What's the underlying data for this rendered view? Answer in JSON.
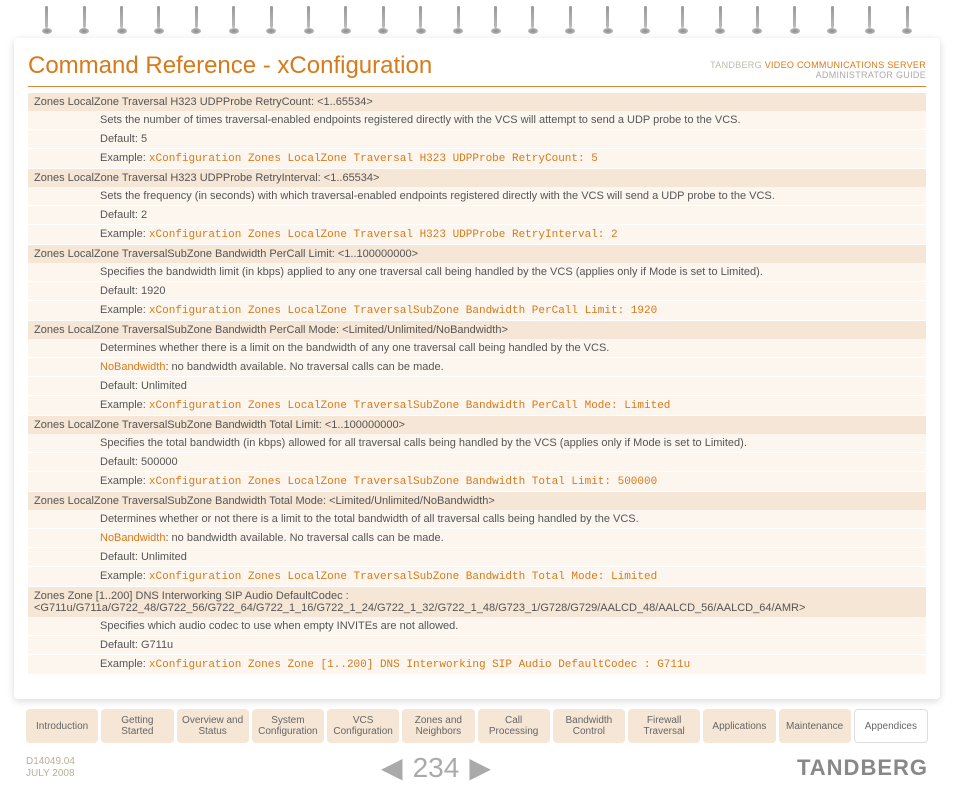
{
  "header": {
    "title": "Command Reference - xConfiguration",
    "brand": "TANDBERG",
    "product": "VIDEO COMMUNICATIONS SERVER",
    "subtitle": "ADMINISTRATOR GUIDE"
  },
  "tabs": [
    "Introduction",
    "Getting Started",
    "Overview and Status",
    "System Configuration",
    "VCS Configuration",
    "Zones and Neighbors",
    "Call Processing",
    "Bandwidth Control",
    "Firewall Traversal",
    "Applications",
    "Maintenance",
    "Appendices"
  ],
  "pager": {
    "page": "234",
    "left": "◀",
    "right": "▶"
  },
  "footer": {
    "docid": "D14049.04",
    "date": "JULY 2008",
    "logo": "TANDBERG"
  },
  "items": [
    {
      "hdr": "Zones LocalZone Traversal H323 UDPProbe RetryCount: <1..65534>",
      "body": [
        "Sets the number of times traversal-enabled endpoints registered directly with the VCS will attempt to send a UDP probe to the VCS.",
        "Default: 5"
      ],
      "example": "xConfiguration Zones LocalZone Traversal H323 UDPProbe RetryCount: 5"
    },
    {
      "hdr": "Zones LocalZone Traversal H323 UDPProbe RetryInterval: <1..65534>",
      "body": [
        "Sets the frequency (in seconds) with which traversal-enabled endpoints registered directly with the VCS will send a UDP probe to the VCS.",
        "Default: 2"
      ],
      "example": "xConfiguration Zones LocalZone Traversal H323 UDPProbe RetryInterval: 2"
    },
    {
      "hdr": "Zones LocalZone TraversalSubZone Bandwidth PerCall Limit: <1..100000000>",
      "body": [
        "Specifies the bandwidth limit (in kbps) applied to any one traversal call being handled by the VCS (applies only if Mode is set to Limited).",
        "Default: 1920"
      ],
      "example": "xConfiguration Zones LocalZone TraversalSubZone Bandwidth PerCall Limit: 1920"
    },
    {
      "hdr": "Zones LocalZone TraversalSubZone Bandwidth PerCall Mode: <Limited/Unlimited/NoBandwidth>",
      "body": [
        "Determines whether there is a limit on the bandwidth of any one traversal call being handled by the VCS."
      ],
      "nobw": {
        "label": "NoBandwidth",
        "text": ": no bandwidth available. No traversal calls can be made."
      },
      "body2": [
        "Default: Unlimited"
      ],
      "example": "xConfiguration Zones LocalZone TraversalSubZone Bandwidth PerCall Mode: Limited"
    },
    {
      "hdr": "Zones LocalZone TraversalSubZone Bandwidth Total Limit: <1..100000000>",
      "body": [
        "Specifies the total bandwidth (in kbps) allowed for all traversal calls being handled by the VCS (applies only if Mode is set to Limited).",
        "Default: 500000"
      ],
      "example": "xConfiguration Zones LocalZone TraversalSubZone Bandwidth Total Limit: 500000"
    },
    {
      "hdr": "Zones LocalZone TraversalSubZone Bandwidth Total Mode: <Limited/Unlimited/NoBandwidth>",
      "body": [
        "Determines whether or not there is a limit to the total bandwidth of all traversal calls being handled by the VCS."
      ],
      "nobw": {
        "label": "NoBandwidth",
        "text": ": no bandwidth available. No traversal calls can be made."
      },
      "body2": [
        "Default: Unlimited"
      ],
      "example": "xConfiguration Zones LocalZone TraversalSubZone Bandwidth Total Mode: Limited"
    },
    {
      "hdr": "Zones Zone [1..200] DNS Interworking SIP Audio DefaultCodec : <G711u/G711a/G722_48/G722_56/G722_64/G722_1_16/G722_1_24/G722_1_32/G722_1_48/G723_1/G728/G729/AALCD_48/AALCD_56/AALCD_64/AMR>",
      "body": [
        "Specifies which audio codec to use when empty INVITEs are not allowed.",
        "Default: G711u"
      ],
      "example": "xConfiguration Zones Zone [1..200] DNS Interworking SIP Audio DefaultCodec : G711u"
    }
  ],
  "labels": {
    "example": "Example"
  }
}
